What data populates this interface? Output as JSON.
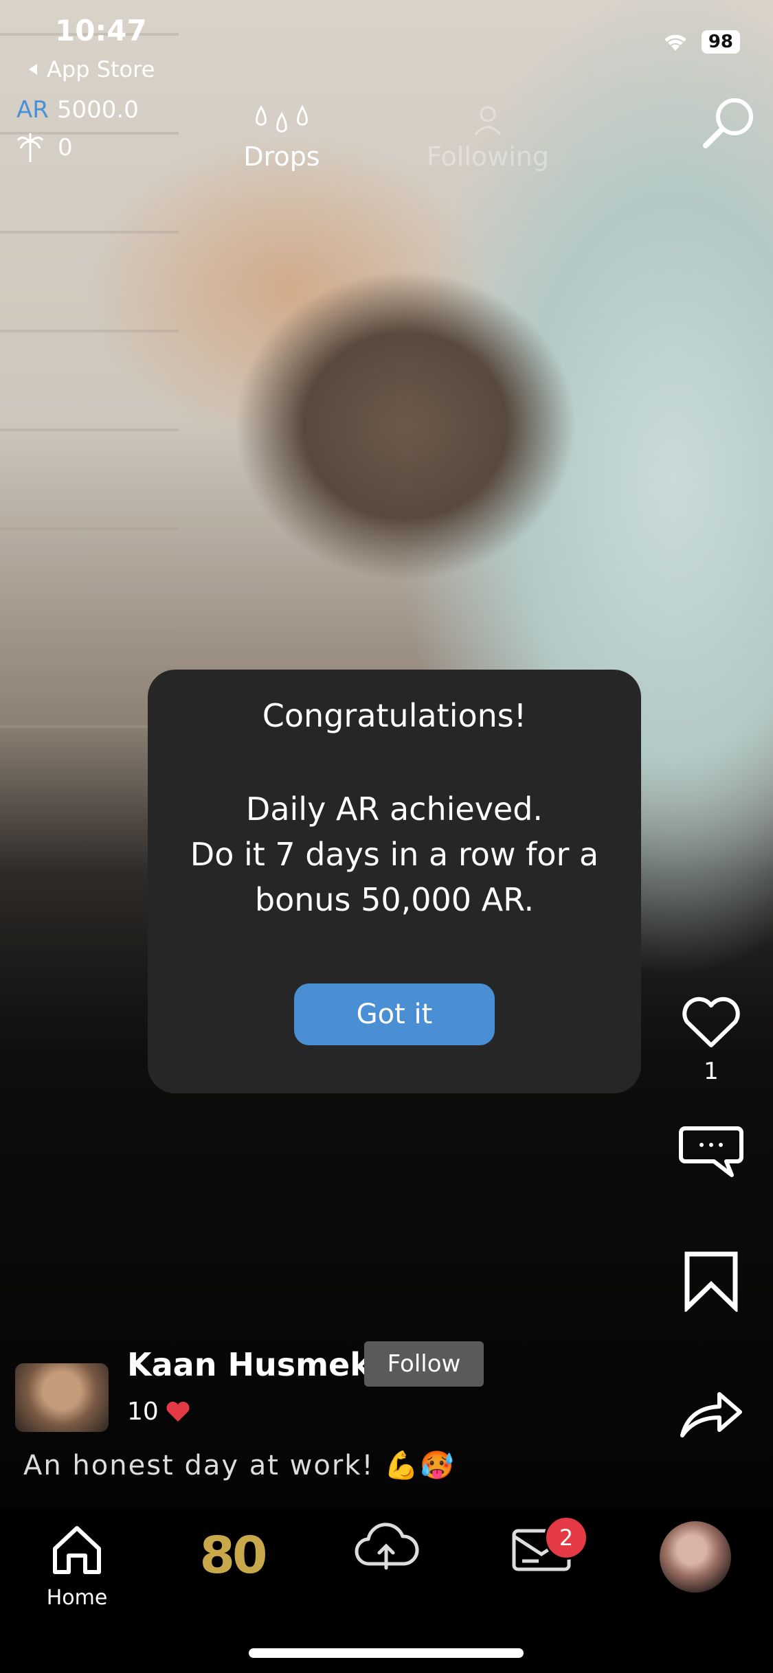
{
  "status_bar": {
    "time": "10:47",
    "back_label": "App Store",
    "battery": "98"
  },
  "balance": {
    "ar_label": "AR",
    "ar_value": "5000.0",
    "palm_value": "0"
  },
  "top_tabs": {
    "drops": "Drops",
    "following": "Following"
  },
  "modal": {
    "title": "Congratulations!",
    "line1": "Daily AR achieved.",
    "line2": "Do it 7 days in a row for a",
    "line3": "bonus 50,000 AR.",
    "button": "Got it"
  },
  "actions": {
    "like_count": "1"
  },
  "creator": {
    "name": "Kaan Husmek",
    "follow_label": "Follow",
    "hearts": "10",
    "caption": "An honest day at work! 💪🥵"
  },
  "nav": {
    "home_label": "Home",
    "eighty": "80",
    "inbox_badge": "2"
  },
  "colors": {
    "accent": "#4a8fd4",
    "gold": "#c9a84c",
    "badge": "#e53945"
  }
}
